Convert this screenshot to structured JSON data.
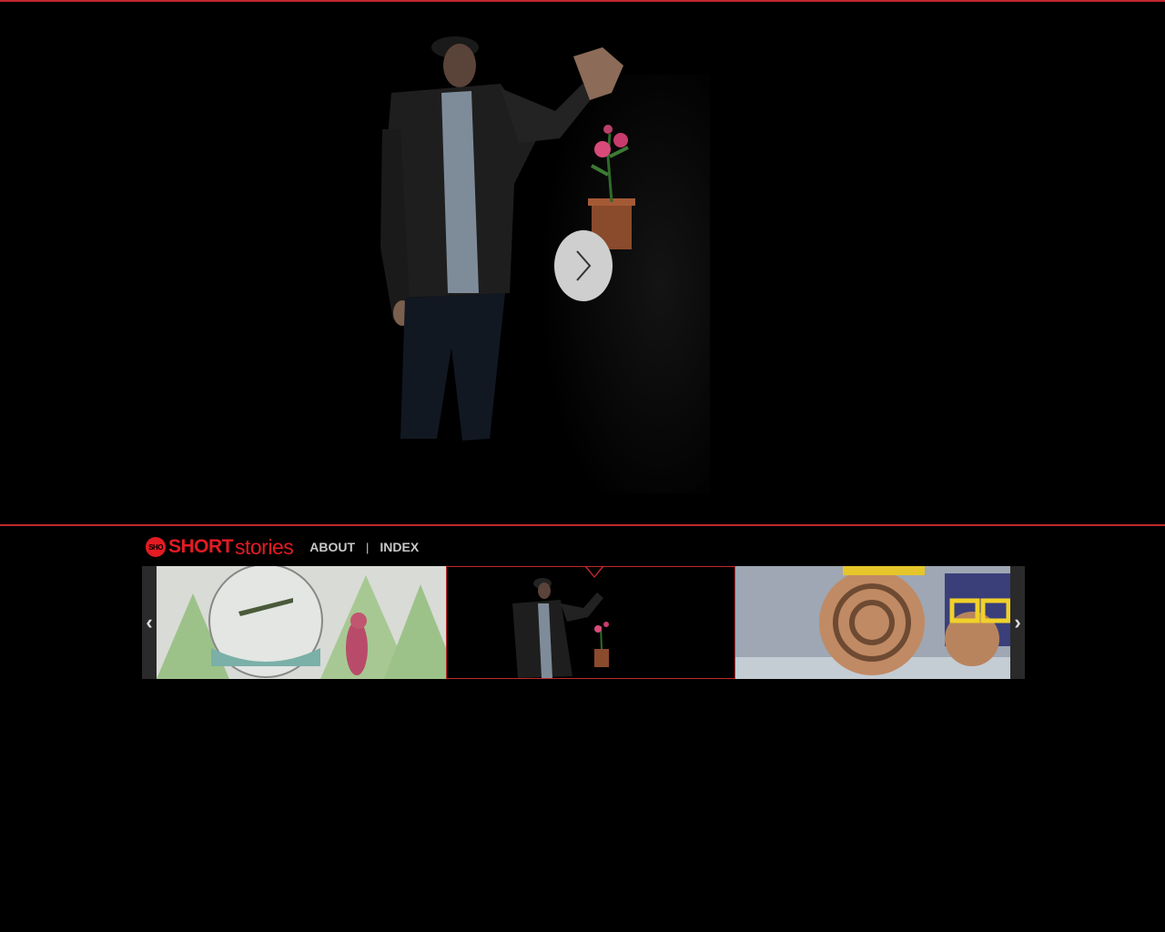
{
  "brand": {
    "mark": "SHO",
    "word_short": "SHORT",
    "word_stories": "stories",
    "color": "#e31b23"
  },
  "nav": {
    "about": "ABOUT",
    "separator": "|",
    "index": "INDEX"
  },
  "hero": {
    "play_icon": "chevron-right-icon"
  },
  "carousel": {
    "prev_glyph": "‹",
    "next_glyph": "›",
    "items": [
      {
        "name": "sketch-animation",
        "active": false
      },
      {
        "name": "man-with-flower",
        "active": true
      },
      {
        "name": "yellow-glasses",
        "active": false
      }
    ]
  },
  "colors": {
    "accent": "#c1272d",
    "background": "#000000"
  }
}
